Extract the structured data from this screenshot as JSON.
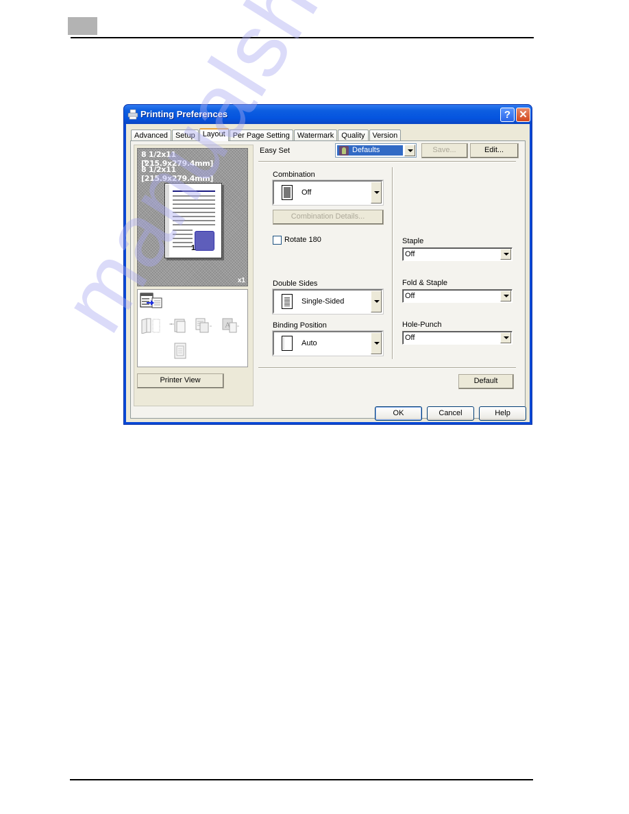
{
  "page": {
    "watermark": "manualshive.com"
  },
  "dialog": {
    "title": "Printing Preferences",
    "title_buttons": {
      "help": "?",
      "close": "✕"
    },
    "tabs": [
      {
        "label": "Advanced",
        "active": false
      },
      {
        "label": "Setup",
        "active": false
      },
      {
        "label": "Layout",
        "active": true
      },
      {
        "label": "Per Page Setting",
        "active": false
      },
      {
        "label": "Watermark",
        "active": false
      },
      {
        "label": "Quality",
        "active": false
      },
      {
        "label": "Version",
        "active": false
      }
    ],
    "preview": {
      "original_size": "8 1/2x11 [215.9x279.4mm]",
      "arrow": "▼",
      "output_size": "8 1/2x11 [215.9x279.4mm]",
      "copies": "x1",
      "page_number": "1",
      "printer_view_label": "Printer View",
      "icons": [
        "printer-settings-icon",
        "booklet-icon",
        "combination-icon",
        "duplex-icon",
        "overlay-icon",
        "watermark-page-icon"
      ]
    },
    "easy_set": {
      "label": "Easy Set",
      "selected": "Defaults",
      "save_label": "Save...",
      "edit_label": "Edit..."
    },
    "combination": {
      "label": "Combination",
      "value": "Off",
      "details_label": "Combination Details..."
    },
    "rotate": {
      "label": "Rotate 180",
      "checked": false
    },
    "double_sides": {
      "label": "Double Sides",
      "value": "Single-Sided"
    },
    "binding_position": {
      "label": "Binding Position",
      "value": "Auto"
    },
    "staple": {
      "label": "Staple",
      "value": "Off"
    },
    "fold_staple": {
      "label": "Fold & Staple",
      "value": "Off"
    },
    "hole_punch": {
      "label": "Hole-Punch",
      "value": "Off"
    },
    "default_label": "Default",
    "footer": {
      "ok": "OK",
      "cancel": "Cancel",
      "help": "Help"
    }
  },
  "colors": {
    "titlebar": "#0554df",
    "dialog_face": "#ece9d8",
    "selection": "#316ac5",
    "active_tab_accent": "#e8a33a"
  }
}
